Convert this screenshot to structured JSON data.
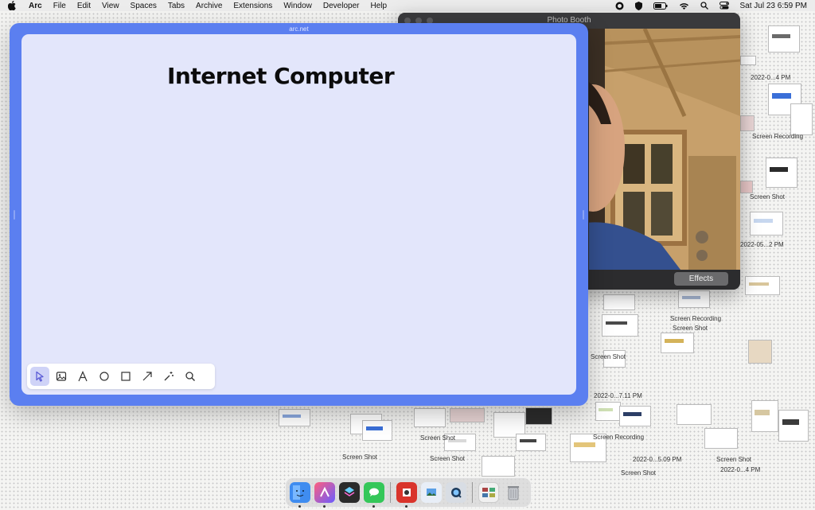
{
  "menubar": {
    "items": [
      "Arc",
      "File",
      "Edit",
      "View",
      "Spaces",
      "Tabs",
      "Archive",
      "Extensions",
      "Window",
      "Developer",
      "Help"
    ],
    "clock": "Sat Jul 23  6:59 PM"
  },
  "photobooth": {
    "title": "Photo Booth",
    "effects_label": "Effects"
  },
  "arc": {
    "url": "arc.net",
    "canvas_title": "Internet Computer",
    "tools": [
      {
        "name": "select-tool",
        "icon": "cursor-icon",
        "active": true
      },
      {
        "name": "image-tool",
        "icon": "image-icon"
      },
      {
        "name": "text-tool",
        "icon": "text-icon"
      },
      {
        "name": "circle-tool",
        "icon": "circle-icon"
      },
      {
        "name": "rectangle-tool",
        "icon": "square-icon"
      },
      {
        "name": "arrow-tool",
        "icon": "arrow-icon"
      },
      {
        "name": "magic-tool",
        "icon": "sparkle-icon"
      },
      {
        "name": "zoom-tool",
        "icon": "magnifier-icon"
      }
    ]
  },
  "desktop": {
    "file_labels": [
      "Screen Recording",
      "Screen Shot",
      "2022-0...4 PM",
      "Screen Recording",
      "Screen Shot",
      "2022-05...2 PM",
      "Screen Shot",
      "2022-0...7.11 PM",
      "Screen Shot",
      "2022-0...5.09 PM"
    ]
  },
  "dock": {
    "apps": [
      "finder-icon",
      "arc-icon",
      "shortcuts-icon",
      "messages-icon",
      "photo-booth-icon",
      "preview-icon",
      "quicktime-icon",
      "screenshot-folder-icon",
      "trash-icon"
    ]
  }
}
